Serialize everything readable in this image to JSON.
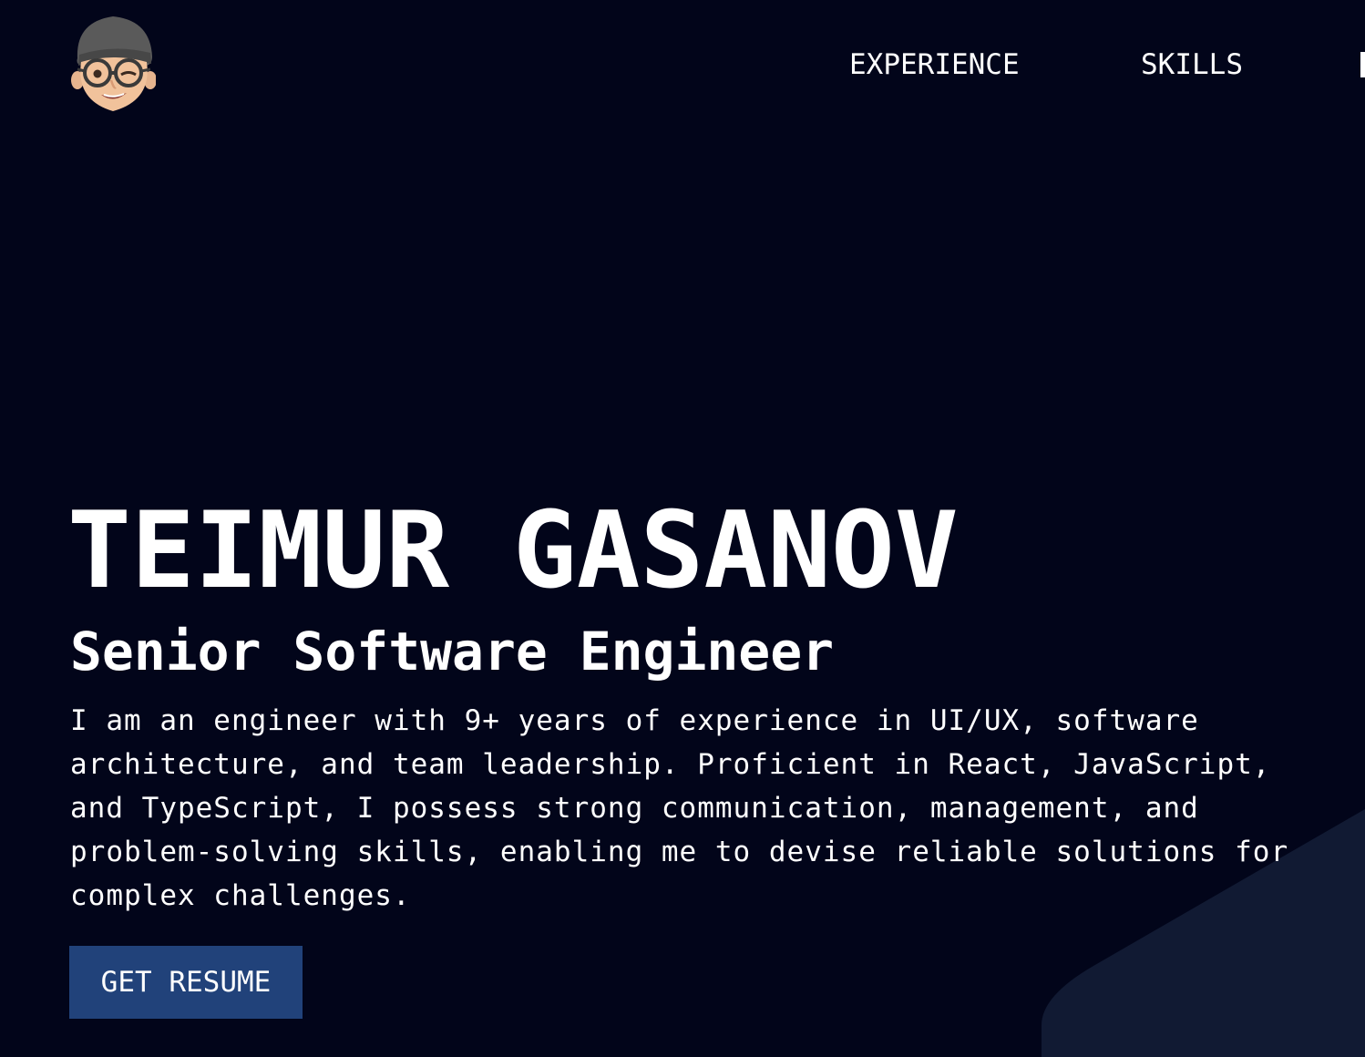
{
  "header": {
    "avatar_icon": "memoji-avatar-icon",
    "nav": {
      "experience": "EXPERIENCE",
      "skills": "SKILLS"
    }
  },
  "hero": {
    "name": "TEIMUR GASANOV",
    "title": "Senior Software Engineer",
    "bio": "I am an engineer with 9+ years of experience in UI/UX, software architecture, and team leadership. Proficient in React, JavaScript, and TypeScript, I possess strong communication, management, and problem-solving skills, enabling me to devise reliable solutions for complex challenges.",
    "cta_label": "GET RESUME"
  },
  "colors": {
    "background": "#02051a",
    "accent_panel": "#111a33",
    "button": "#21427a",
    "text": "#ffffff"
  }
}
